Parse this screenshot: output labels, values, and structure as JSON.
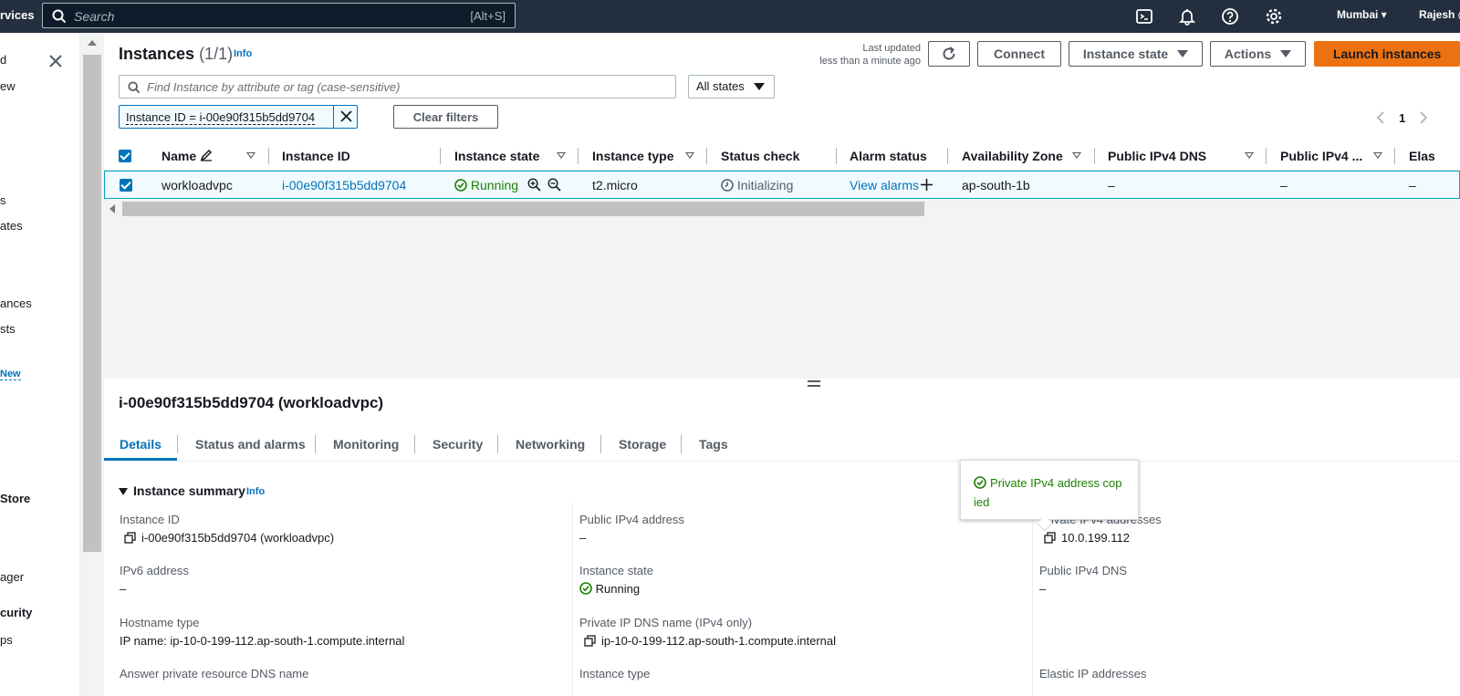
{
  "topnav": {
    "services": "rvices",
    "search_placeholder": "Search",
    "search_shortcut": "[Alt+S]",
    "region": "Mumbai",
    "user": "Rajesh @"
  },
  "sidebar": {
    "items": [
      "d",
      "ew",
      "s",
      "ates",
      "ances",
      "sts",
      "New",
      "Store",
      "ager",
      "curity",
      "ps"
    ]
  },
  "instances": {
    "title": "Instances",
    "count": "(1/1)",
    "info": "Info",
    "last_updated_line1": "Last updated",
    "last_updated_line2": "less than a minute ago",
    "connect": "Connect",
    "instance_state": "Instance state",
    "actions": "Actions",
    "launch": "Launch instances",
    "search_placeholder": "Find Instance by attribute or tag (case-sensitive)",
    "state_filter": "All states",
    "filter_token": "Instance ID = i-00e90f315b5dd9704",
    "clear_filters": "Clear filters",
    "page": "1"
  },
  "table": {
    "columns": [
      "Name",
      "Instance ID",
      "Instance state",
      "Instance type",
      "Status check",
      "Alarm status",
      "Availability Zone",
      "Public IPv4 DNS",
      "Public IPv4 ...",
      "Elas"
    ],
    "row": {
      "name": "workloadvpc",
      "instance_id": "i-00e90f315b5dd9704",
      "state": "Running",
      "type": "t2.micro",
      "status_check": "Initializing",
      "alarm": "View alarms",
      "az": "ap-south-1b",
      "public_dns": "–",
      "public_ipv4": "–",
      "elastic": "–"
    }
  },
  "details": {
    "title": "i-00e90f315b5dd9704 (workloadvpc)",
    "tabs": [
      "Details",
      "Status and alarms",
      "Monitoring",
      "Security",
      "Networking",
      "Storage",
      "Tags"
    ],
    "summary": "Instance summary",
    "info": "Info",
    "fields": {
      "instance_id_label": "Instance ID",
      "instance_id_value": "i-00e90f315b5dd9704 (workloadvpc)",
      "ipv6_label": "IPv6 address",
      "ipv6_value": "–",
      "hostname_type_label": "Hostname type",
      "hostname_type_value": "IP name: ip-10-0-199-112.ap-south-1.compute.internal",
      "answer_dns_label": "Answer private resource DNS name",
      "public_ipv4_label": "Public IPv4 address",
      "public_ipv4_value": "–",
      "instance_state_label": "Instance state",
      "instance_state_value": "Running",
      "private_dns_label": "Private IP DNS name (IPv4 only)",
      "private_dns_value": "ip-10-0-199-112.ap-south-1.compute.internal",
      "instance_type_label": "Instance type",
      "private_ipv4_label": "Private IPv4 addresses",
      "private_ipv4_value": "10.0.199.112",
      "public_dns_label": "Public IPv4 DNS",
      "public_dns_value": "–",
      "elastic_ip_label": "Elastic IP addresses"
    },
    "popover_line1": "Private IPv4 address cop",
    "popover_line2": "ied"
  },
  "colors": {
    "nav_bg": "#232f3e",
    "accent": "#0073bb",
    "primary_button": "#ec7211",
    "success": "#1d8102"
  }
}
